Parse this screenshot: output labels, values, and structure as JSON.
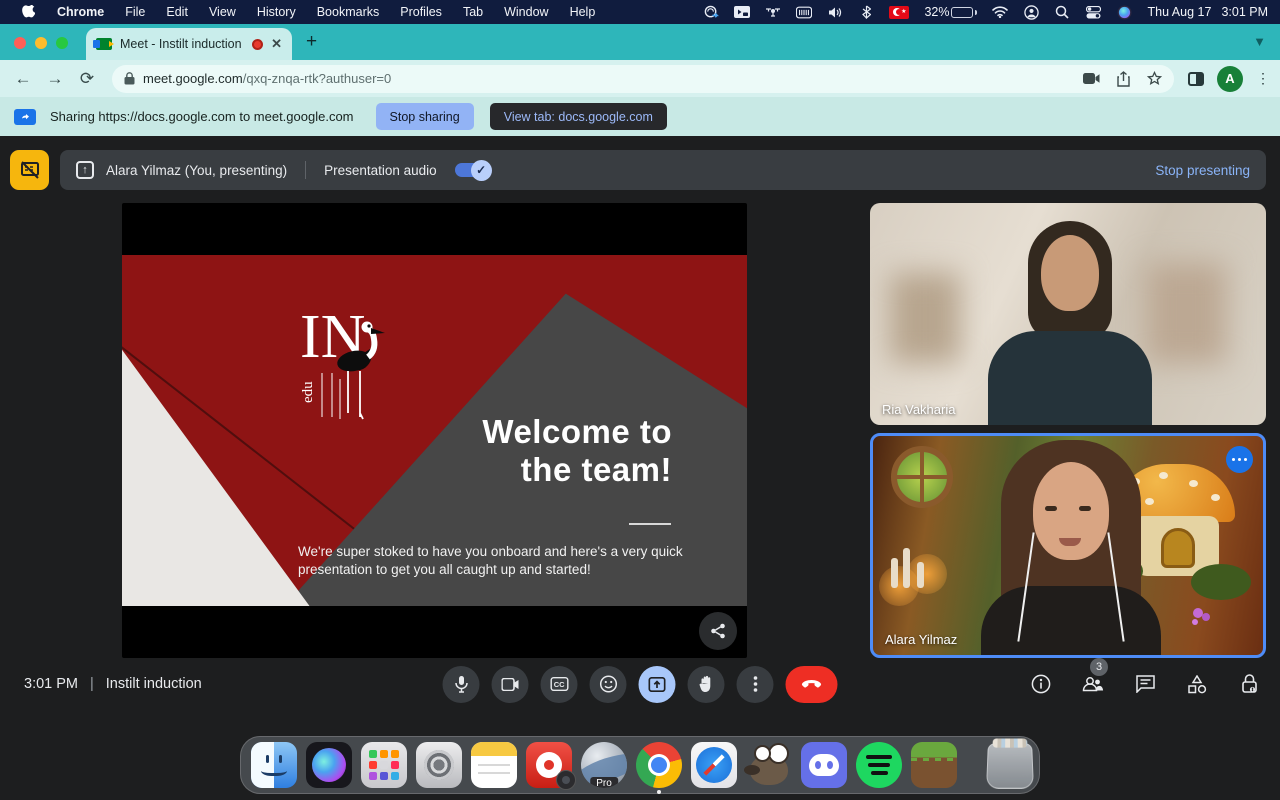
{
  "menubar": {
    "app_name": "Chrome",
    "items": [
      "File",
      "Edit",
      "View",
      "History",
      "Bookmarks",
      "Profiles",
      "Tab",
      "Window",
      "Help"
    ],
    "battery_percent": "32%",
    "clock_date": "Thu Aug 17",
    "clock_time": "3:01 PM"
  },
  "browser": {
    "tab_title": "Meet - Instilt induction",
    "new_tab_label": "+",
    "url_host": "meet.google.com",
    "url_path": "/qxq-znqa-rtk?authuser=0",
    "avatar_letter": "A",
    "banner_text": "Sharing https://docs.google.com to meet.google.com",
    "stop_sharing_label": "Stop sharing",
    "view_tab_label": "View tab: docs.google.com"
  },
  "meet": {
    "presenter_label": "Alara Yilmaz (You, presenting)",
    "presentation_audio_label": "Presentation audio",
    "stop_presenting_label": "Stop presenting",
    "time": "3:01 PM",
    "meeting_name": "Instilt induction",
    "participants_badge": "3",
    "tiles": [
      {
        "name": "Ria Vakharia"
      },
      {
        "name": "Alara Yilmaz"
      }
    ],
    "slide": {
      "logo_main": "IN",
      "logo_sub": "edu",
      "title_line1": "Welcome to",
      "title_line2": "the team!",
      "body": "We're super stoked to have you onboard and here's a very quick presentation to get you all caught up and started!"
    },
    "colors": {
      "accent_blue": "#8ab4f8",
      "end_call_red": "#ee2e24",
      "slide_red": "#8e1414",
      "presenting_yellow": "#f6b60d",
      "tile_border_blue": "#4e8cf7"
    }
  },
  "dock": {
    "earth_pro_label": "Pro"
  }
}
